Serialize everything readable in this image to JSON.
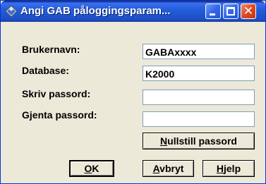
{
  "window": {
    "title": "Angi GAB påloggingsparam...",
    "title_icon": "app-diamond-icon",
    "controls": {
      "minimize": "minimize-icon",
      "maximize": "maximize-icon",
      "close": "close-icon"
    }
  },
  "form": {
    "username": {
      "label": "Brukernavn:",
      "value": "GABAxxxx"
    },
    "database": {
      "label": "Database:",
      "value": "K2000"
    },
    "password": {
      "label": "Skriv passord:",
      "value": ""
    },
    "repeat_password": {
      "label": "Gjenta passord:",
      "value": ""
    }
  },
  "buttons": {
    "reset": {
      "mnemonic": "N",
      "rest": "ullstill passord"
    },
    "ok": {
      "mnemonic": "O",
      "rest": "K"
    },
    "cancel": {
      "mnemonic": "A",
      "rest": "vbryt"
    },
    "help": {
      "mnemonic": "H",
      "rest": "jelp"
    }
  },
  "colors": {
    "titlebar": "#245edb",
    "dialog_bg": "#ece9d8",
    "close_button": "#df4a22"
  }
}
